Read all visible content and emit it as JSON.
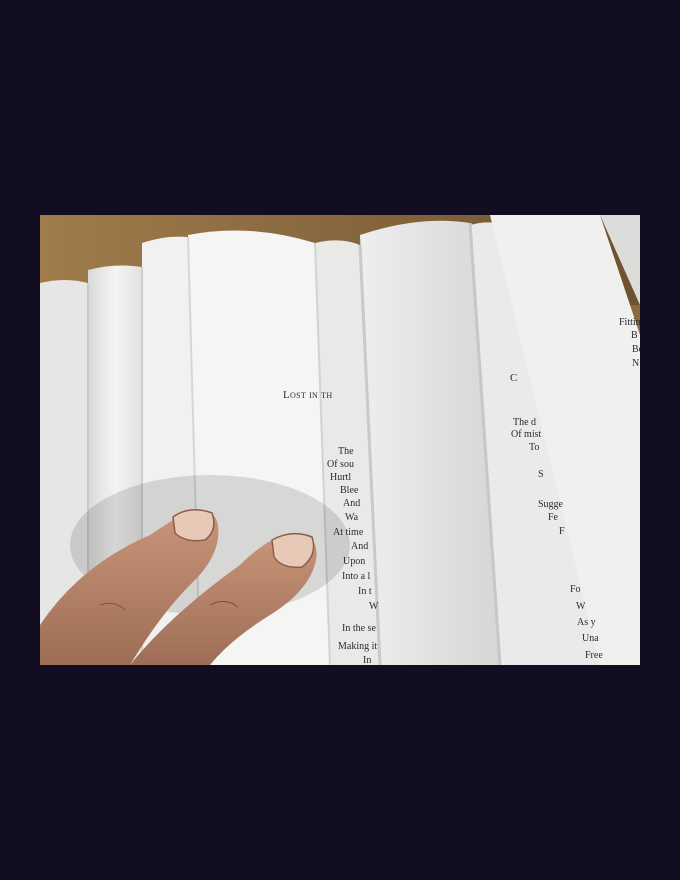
{
  "photo": {
    "subject": "photograph of a fanned-open printed book with two fingers holding the pages",
    "poem_title": "Lost in th",
    "left_lines": [
      "The",
      "Of sou",
      "Hurtl",
      "Blee",
      "And",
      "Wa",
      "At time",
      "And",
      "Upon",
      "Into a l",
      "In t",
      "W",
      "In the se",
      "Making it",
      "In"
    ],
    "mid_title": "C",
    "mid_lines": [
      "The d",
      "Of mist",
      "To",
      "S",
      "Sugge",
      "Fe",
      "F"
    ],
    "right_top_lines": [
      "Fitting tl",
      "B",
      "Bo",
      "N"
    ],
    "right_bottom_lines": [
      "Fo",
      "W",
      "As y",
      "Una",
      "Free"
    ],
    "colors": {
      "background": "#130d22",
      "paper": "#f2f2f0",
      "cardboard": "#8c6a3e",
      "skin": "#b98a6c",
      "ink": "#2b2b2b"
    }
  }
}
